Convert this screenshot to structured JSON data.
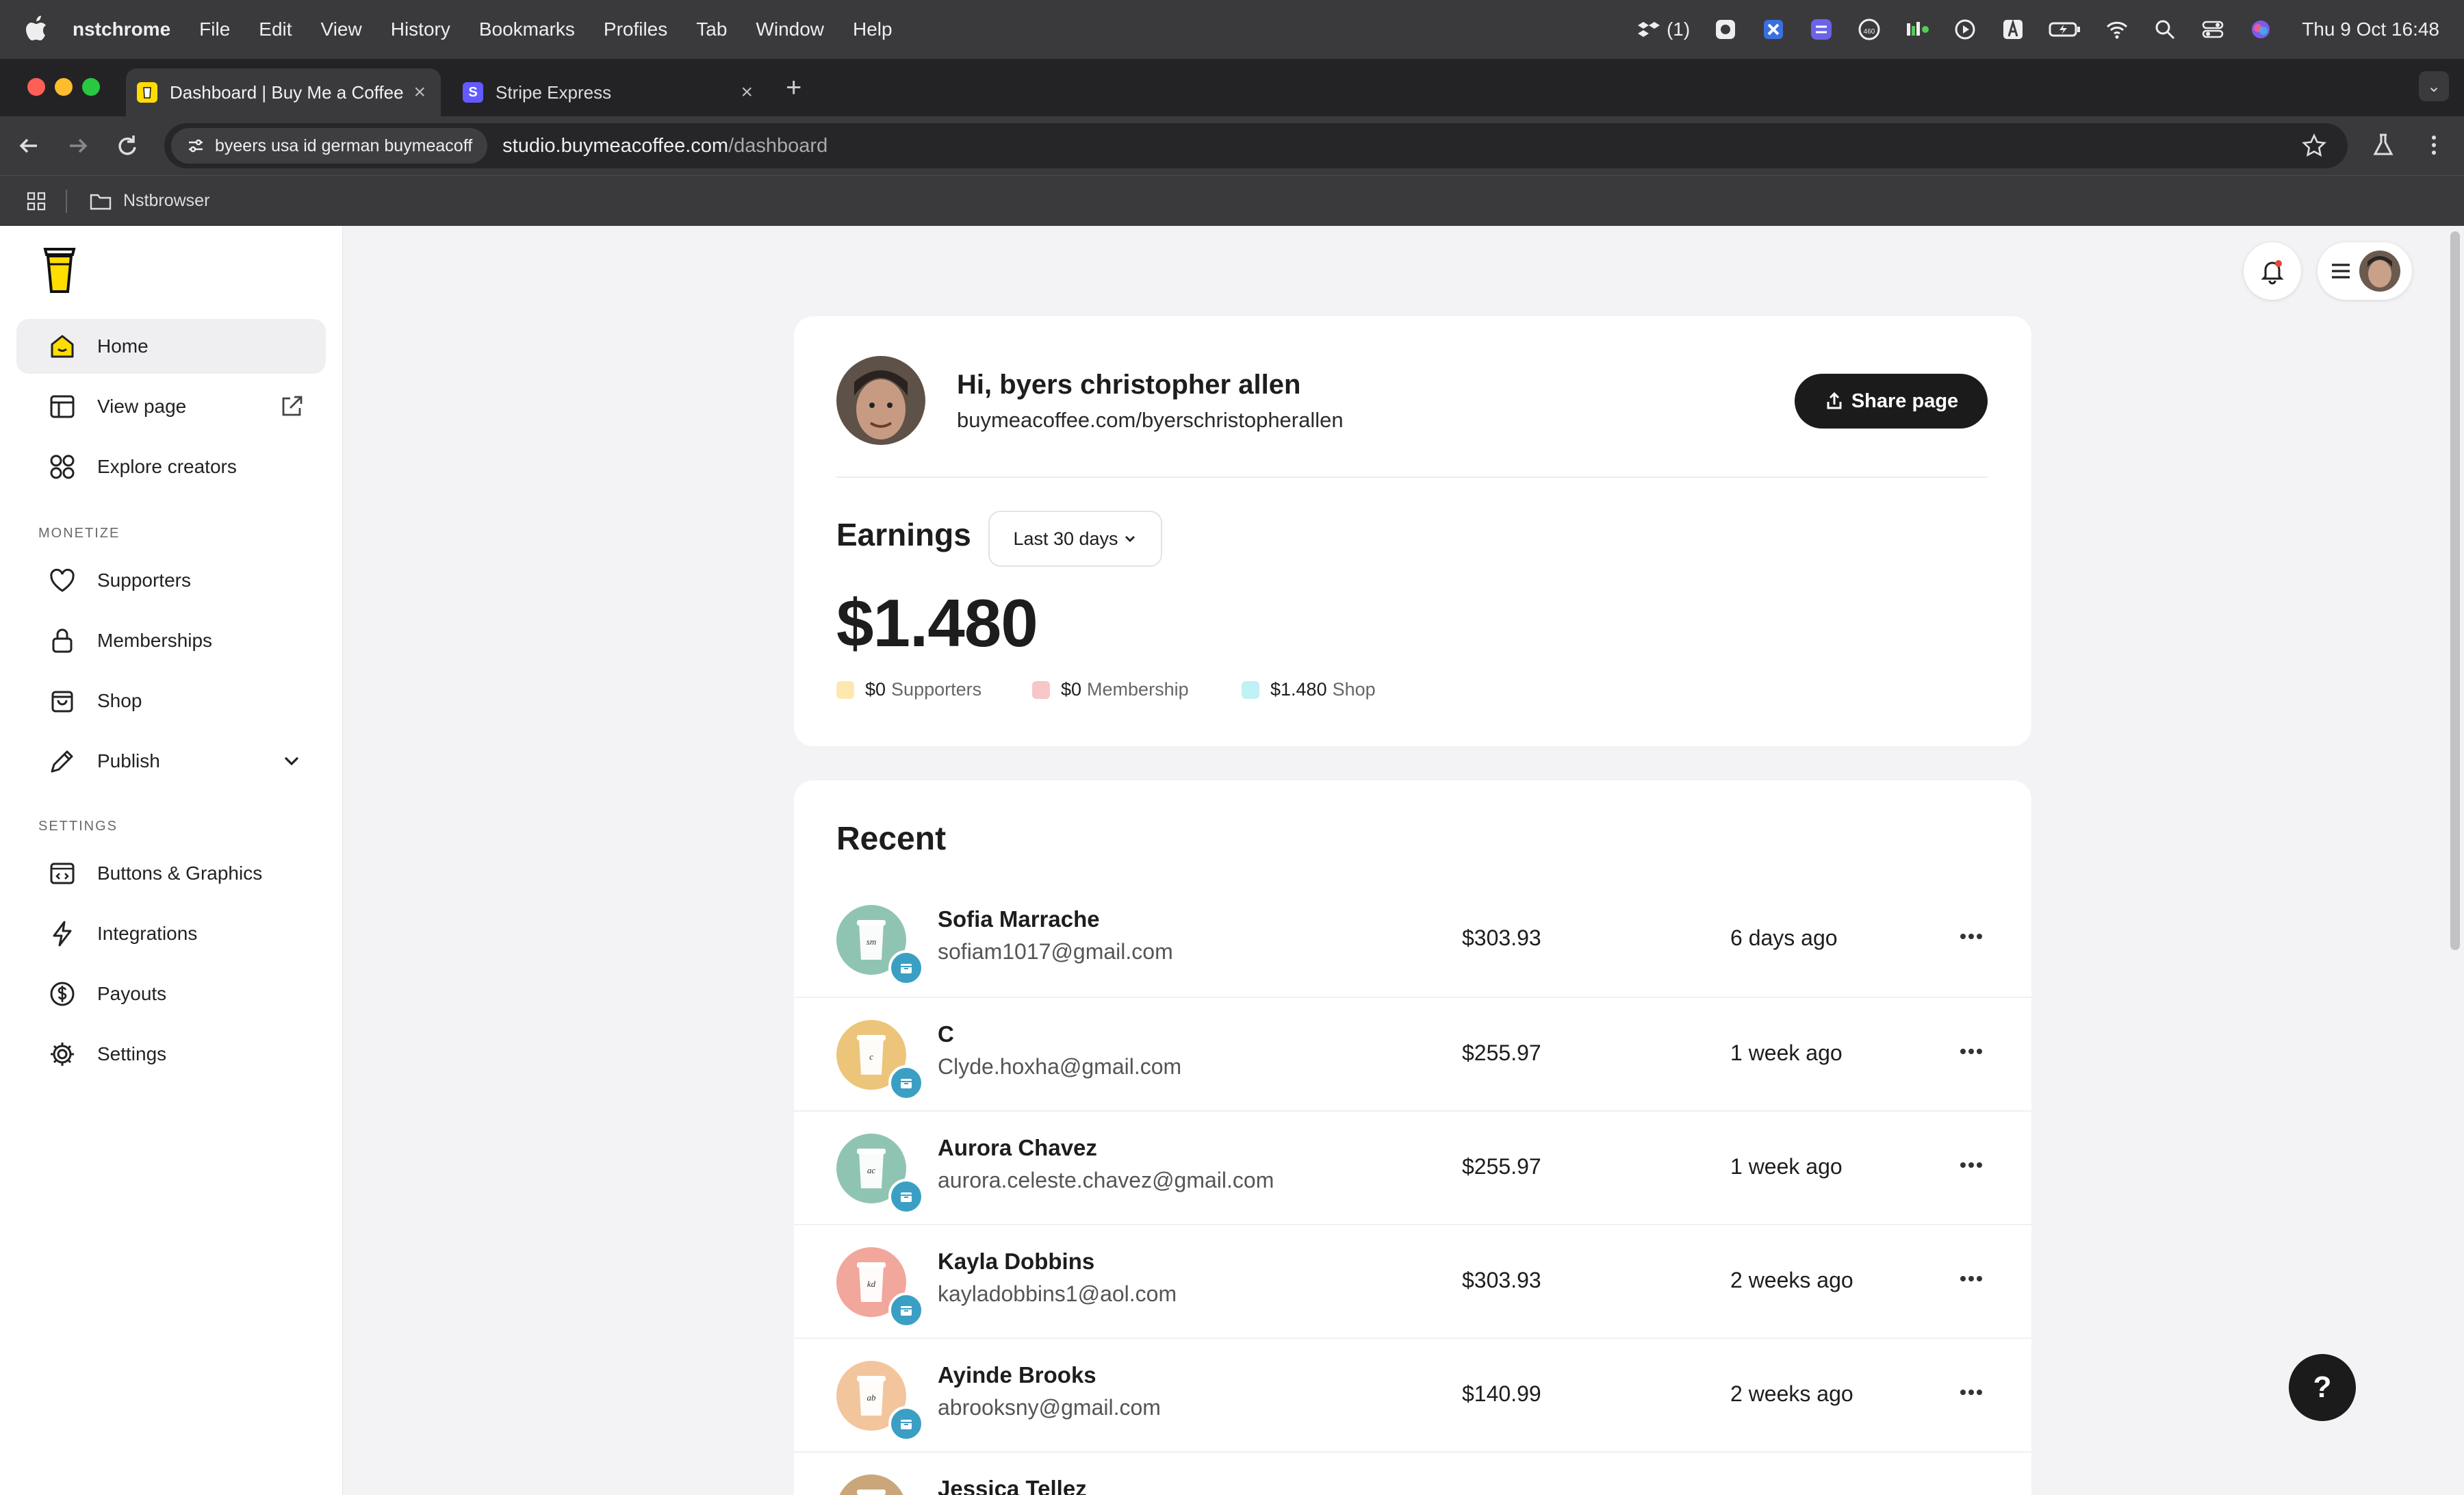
{
  "menubar": {
    "app": "nstchrome",
    "items": [
      "File",
      "Edit",
      "View",
      "History",
      "Bookmarks",
      "Profiles",
      "Tab",
      "Window",
      "Help"
    ],
    "tray_badge": "(1)",
    "clock": "Thu 9 Oct  16:48"
  },
  "tabs": [
    {
      "title": "Dashboard | Buy Me a Coffee",
      "favicon": "bmc-cup-icon",
      "active": true
    },
    {
      "title": "Stripe Express",
      "favicon_letter": "S",
      "active": false
    }
  ],
  "address": {
    "site_chip": "byeers usa id german buymeacoff",
    "host": "studio.buymeacoffee.com",
    "path": "/dashboard"
  },
  "bookmarks": {
    "folder": "Nstbrowser"
  },
  "sidebar": {
    "items": [
      {
        "label": "Home",
        "icon": "home-icon"
      },
      {
        "label": "View page",
        "icon": "layout-icon"
      },
      {
        "label": "Explore creators",
        "icon": "grid-icon"
      }
    ],
    "monetize_label": "MONETIZE",
    "monetize": [
      {
        "label": "Supporters",
        "icon": "heart-icon"
      },
      {
        "label": "Memberships",
        "icon": "lock-icon"
      },
      {
        "label": "Shop",
        "icon": "bag-icon"
      },
      {
        "label": "Publish",
        "icon": "pencil-icon"
      }
    ],
    "settings_label": "SETTINGS",
    "settings": [
      {
        "label": "Buttons & Graphics",
        "icon": "code-window-icon"
      },
      {
        "label": "Integrations",
        "icon": "bolt-icon"
      },
      {
        "label": "Payouts",
        "icon": "dollar-icon"
      },
      {
        "label": "Settings",
        "icon": "gear-icon"
      }
    ]
  },
  "profile": {
    "greeting": "Hi, byers christopher allen",
    "link": "buymeacoffee.com/byerschristopherallen",
    "share_label": "Share page"
  },
  "earnings": {
    "title": "Earnings",
    "period": "Last 30 days",
    "total": "$1.480",
    "legend": [
      {
        "amount": "$0",
        "label": "Supporters",
        "color": "#fde9b0"
      },
      {
        "amount": "$0",
        "label": "Membership",
        "color": "#f8c6c6"
      },
      {
        "amount": "$1.480",
        "label": "Shop",
        "color": "#bff1f5"
      }
    ]
  },
  "recent": {
    "title": "Recent",
    "rows": [
      {
        "name": "Sofia Marrache",
        "email": "sofiam1017@gmail.com",
        "amount": "$303.93",
        "when": "6 days ago",
        "initials": "sm",
        "color": "#8fc4b3"
      },
      {
        "name": "C",
        "email": "Clyde.hoxha@gmail.com",
        "amount": "$255.97",
        "when": "1 week ago",
        "initials": "c",
        "color": "#ecc57a"
      },
      {
        "name": "Aurora Chavez",
        "email": "aurora.celeste.chavez@gmail.com",
        "amount": "$255.97",
        "when": "1 week ago",
        "initials": "ac",
        "color": "#8fc4b3"
      },
      {
        "name": "Kayla Dobbins",
        "email": "kayladobbins1@aol.com",
        "amount": "$303.93",
        "when": "2 weeks ago",
        "initials": "kd",
        "color": "#f1a79b"
      },
      {
        "name": "Ayinde Brooks",
        "email": "abrooksny@gmail.com",
        "amount": "$140.99",
        "when": "2 weeks ago",
        "initials": "ab",
        "color": "#f3c59c"
      },
      {
        "name": "Jessica Tellez",
        "email": "",
        "amount": "",
        "when": "",
        "initials": "jt",
        "color": "#c9a77a"
      }
    ]
  },
  "help_label": "?"
}
